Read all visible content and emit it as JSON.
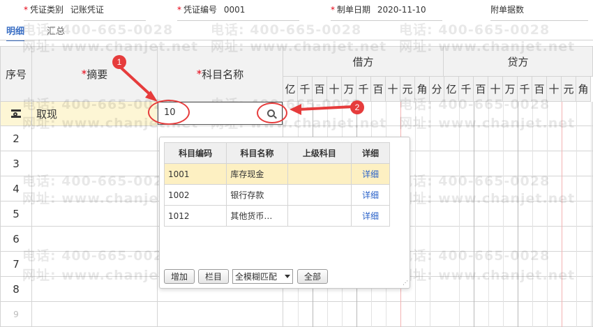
{
  "header": {
    "voucher_type_label": "凭证类别",
    "voucher_type_value": "记账凭证",
    "voucher_no_label": "凭证编号",
    "voucher_no_value": "0001",
    "date_label": "制单日期",
    "date_value": "2020-11-10",
    "attachments_label": "附单据数"
  },
  "tabs": [
    "明细",
    "汇总"
  ],
  "grid": {
    "col_seq": "序号",
    "col_summary": "摘要",
    "col_account": "科目名称",
    "col_debit": "借方",
    "col_credit": "贷方",
    "digits": [
      "亿",
      "千",
      "百",
      "十",
      "万",
      "千",
      "百",
      "十",
      "元",
      "角",
      "分"
    ],
    "credit_digits": [
      "亿",
      "千",
      "百",
      "十",
      "万",
      "千",
      "百",
      "十",
      "元",
      "角"
    ],
    "row1_summary": "取现",
    "row1_account_input": "10",
    "row_numbers": [
      "2",
      "3",
      "4",
      "5",
      "6",
      "7",
      "8",
      "9"
    ]
  },
  "popup": {
    "headers": [
      "科目编码",
      "科目名称",
      "上级科目",
      "详细"
    ],
    "rows": [
      {
        "code": "1001",
        "name": "库存现金",
        "parent": "",
        "detail": "详细"
      },
      {
        "code": "1002",
        "name": "银行存款",
        "parent": "",
        "detail": "详细"
      },
      {
        "code": "1012",
        "name": "其他货币…",
        "parent": "",
        "detail": "详细"
      }
    ],
    "add_button": "增加",
    "columns_button": "栏目",
    "match_select": "全模糊匹配",
    "all_button": "全部"
  },
  "annotations": {
    "badge1": "1",
    "badge2": "2"
  },
  "watermark": {
    "phone": "电话: 400-665-0028",
    "site": "网址: www.chanjet.net"
  },
  "colors": {
    "accent": "#3b6fc4",
    "highlight_row": "#fdf6d5",
    "annotation_red": "#e63c3c",
    "link": "#2a62c9"
  }
}
